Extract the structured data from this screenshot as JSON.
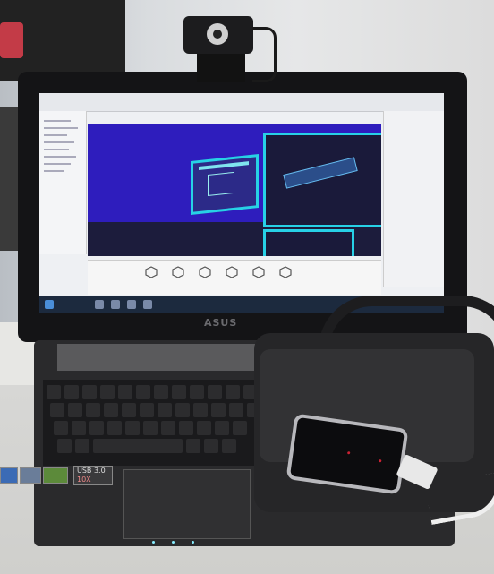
{
  "photo": {
    "laptop_brand": "ASUS",
    "usb_sticker": "USB 3.0",
    "usb_sticker_sub": "10X"
  },
  "colors": {
    "scene_blue": "#2e1dbd",
    "panel_cyan": "#27d1e6",
    "laptop_body": "#2a2a2c",
    "wall": "#e6e7e8"
  }
}
